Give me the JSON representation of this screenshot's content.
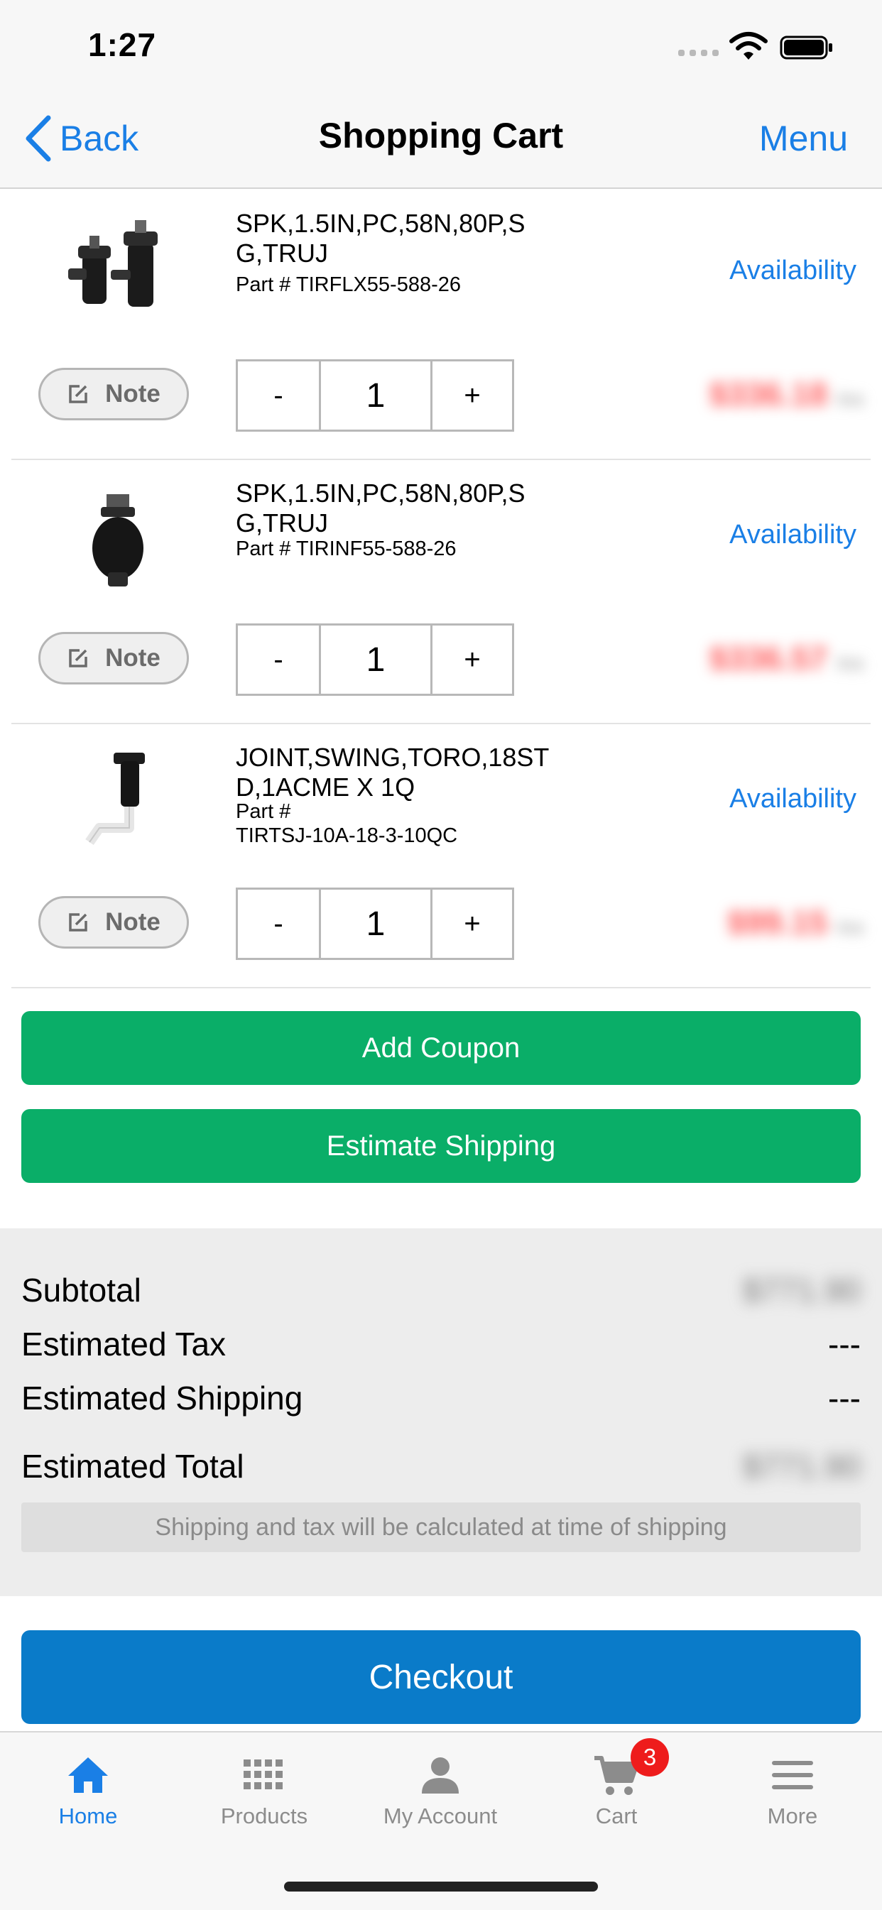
{
  "status_bar": {
    "time": "1:27"
  },
  "nav": {
    "back_label": "Back",
    "title": "Shopping Cart",
    "menu_label": "Menu"
  },
  "items": [
    {
      "name": "SPK,1.5IN,PC,58N,80P,S G,TRUJ",
      "part": "Part # TIRFLX55-588-26",
      "availability": "Availability",
      "note_label": "Note",
      "qty": "1",
      "minus": "-",
      "plus": "+",
      "price": "$336.18",
      "unit": "/ea"
    },
    {
      "name": "SPK,1.5IN,PC,58N,80P,S G,TRUJ",
      "part": "Part # TIRINF55-588-26",
      "availability": "Availability",
      "note_label": "Note",
      "qty": "1",
      "minus": "-",
      "plus": "+",
      "price": "$336.57",
      "unit": "/ea"
    },
    {
      "name": "JOINT,SWING,TORO,18ST D,1ACME X 1Q",
      "part_line1": "Part #",
      "part_line2": "TIRTSJ-10A-18-3-10QC",
      "availability": "Availability",
      "note_label": "Note",
      "qty": "1",
      "minus": "-",
      "plus": "+",
      "price": "$99.15",
      "unit": "/ea"
    }
  ],
  "buttons": {
    "coupon": "Add Coupon",
    "shipping": "Estimate Shipping",
    "checkout": "Checkout"
  },
  "summary": {
    "subtotal_label": "Subtotal",
    "subtotal_value": "$771.90",
    "tax_label": "Estimated Tax",
    "tax_value": "---",
    "shipping_label": "Estimated Shipping",
    "shipping_value": "---",
    "total_label": "Estimated Total",
    "total_value": "$771.90",
    "note": "Shipping and tax will be calculated at time of shipping"
  },
  "tabs": [
    {
      "label": "Home",
      "icon": "home-icon",
      "active": true
    },
    {
      "label": "Products",
      "icon": "grid-icon"
    },
    {
      "label": "My Account",
      "icon": "person-icon"
    },
    {
      "label": "Cart",
      "icon": "cart-icon"
    },
    {
      "label": "More",
      "icon": "menu-icon"
    }
  ],
  "cart_badge": "3",
  "colors": {
    "accent": "#1a7fe6",
    "green": "#0aae68",
    "checkout_blue": "#0a7bc9",
    "badge_red": "#ee1c1c",
    "price_red": "#ff5a5a"
  }
}
